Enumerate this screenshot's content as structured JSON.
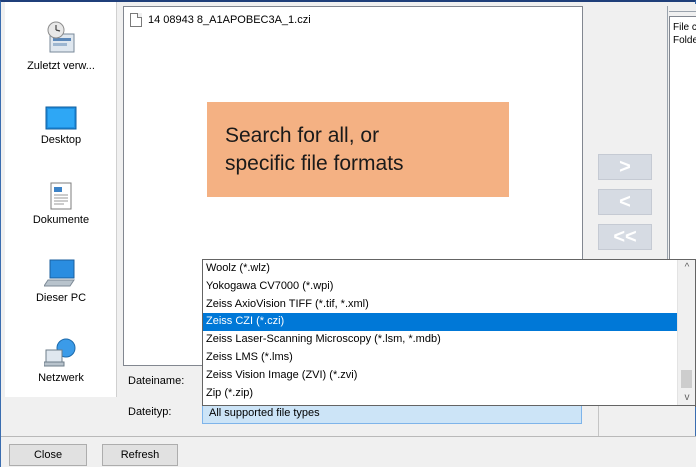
{
  "places": [
    {
      "label": "Zuletzt verw...",
      "icon": "recent-places-icon"
    },
    {
      "label": "Desktop",
      "icon": "desktop-icon"
    },
    {
      "label": "Dokumente",
      "icon": "documents-icon"
    },
    {
      "label": "Dieser PC",
      "icon": "computer-icon"
    },
    {
      "label": "Netzwerk",
      "icon": "network-icon"
    }
  ],
  "file_list": {
    "items": [
      {
        "name": "14 08943 8_A1APOBEC3A_1.czi",
        "icon": "file-icon"
      }
    ]
  },
  "callout": {
    "line1": "Search for all, or",
    "line2": "specific file formats",
    "color": "#f4b183"
  },
  "transfer_buttons": {
    "add": ">",
    "remove": "<",
    "remove_all": "<<"
  },
  "right_panel": {
    "line1": "File c",
    "line2": "Folde"
  },
  "form": {
    "filename_label": "Dateiname:",
    "filetype_label": "Dateityp:",
    "filetype_value": "All supported file types"
  },
  "dropdown": {
    "options": [
      "Woolz (*.wlz)",
      "Yokogawa CV7000 (*.wpi)",
      "Zeiss AxioVision TIFF (*.tif, *.xml)",
      "Zeiss CZI (*.czi)",
      "Zeiss Laser-Scanning Microscopy (*.lsm, *.mdb)",
      "Zeiss LMS (*.lms)",
      "Zeiss Vision Image (ZVI) (*.zvi)",
      "Zip (*.zip)"
    ],
    "selected_index": 3,
    "selection_color": "#0078d7",
    "scroll_up": "^",
    "scroll_down": "v"
  },
  "bottom_bar": {
    "close_label": "Close",
    "refresh_label": "Refresh"
  }
}
